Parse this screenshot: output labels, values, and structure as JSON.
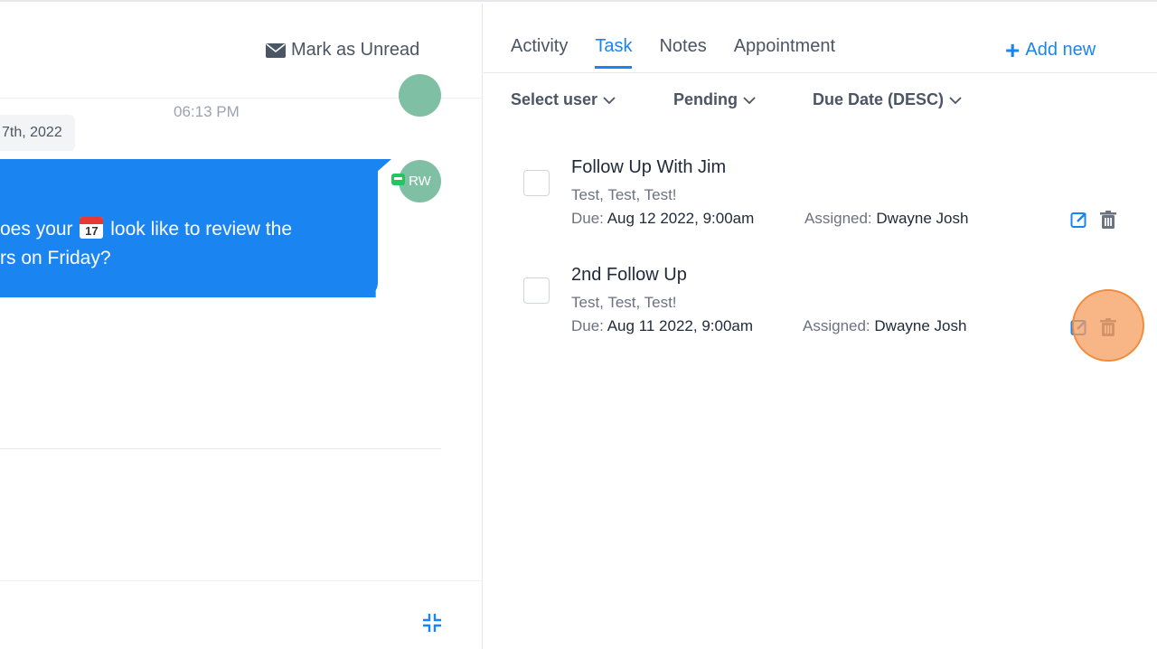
{
  "conversation": {
    "mark_unread_label": "Mark as Unread",
    "timestamp": "06:13 PM",
    "date_chip": "7th, 2022",
    "message_line1_a": "oes your",
    "message_calendar_day": "17",
    "message_line1_b": "look like to review the",
    "message_line2": "rs on Friday?",
    "avatar_initials": "RW"
  },
  "tabs": [
    {
      "label": "Activity"
    },
    {
      "label": "Task"
    },
    {
      "label": "Notes"
    },
    {
      "label": "Appointment"
    }
  ],
  "active_tab": "Task",
  "add_new_label": "Add new",
  "filters": {
    "user": "Select user",
    "status": "Pending",
    "sort": "Due Date (DESC)"
  },
  "tasks": [
    {
      "title": "Follow Up With Jim",
      "description": "Test, Test, Test!",
      "due_label": "Due:",
      "due": "Aug 12 2022, 9:00am",
      "assigned_label": "Assigned:",
      "assigned": "Dwayne Josh"
    },
    {
      "title": "2nd Follow Up",
      "description": "Test, Test, Test!",
      "due_label": "Due:",
      "due": "Aug 11 2022, 9:00am",
      "assigned_label": "Assigned:",
      "assigned": "Dwayne Josh"
    }
  ],
  "colors": {
    "accent": "#1a84f0",
    "bubble": "#1a84f0",
    "avatar": "#7fbfa4",
    "sms_badge": "#22c55e",
    "click_highlight": "#f08c3c"
  }
}
